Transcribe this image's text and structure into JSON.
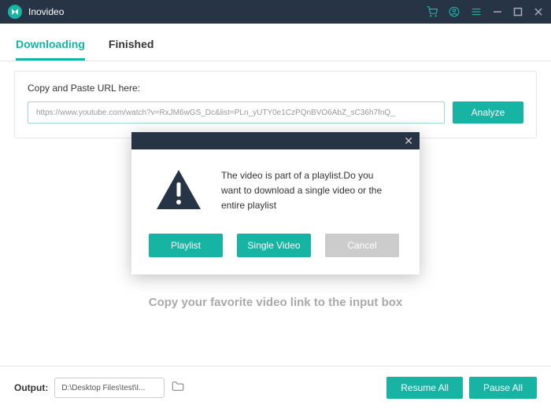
{
  "app": {
    "title": "Inovideo"
  },
  "tabs": {
    "downloading": "Downloading",
    "finished": "Finished"
  },
  "url_panel": {
    "label": "Copy and Paste URL here:",
    "value": "https://www.youtube.com/watch?v=RxJM6wGS_Dc&list=PLn_yUTY0e1CzPQnBVO6AbZ_sC36h7fnQ_",
    "analyze": "Analyze"
  },
  "empty_hint": "Copy your favorite video link to the input box",
  "footer": {
    "output_label": "Output:",
    "output_path": "D:\\Desktop Files\\test\\I...",
    "resume_all": "Resume All",
    "pause_all": "Pause All"
  },
  "modal": {
    "message": "The video is part of a playlist.Do you want to download a single video or the entire playlist",
    "playlist": "Playlist",
    "single": "Single Video",
    "cancel": "Cancel"
  }
}
